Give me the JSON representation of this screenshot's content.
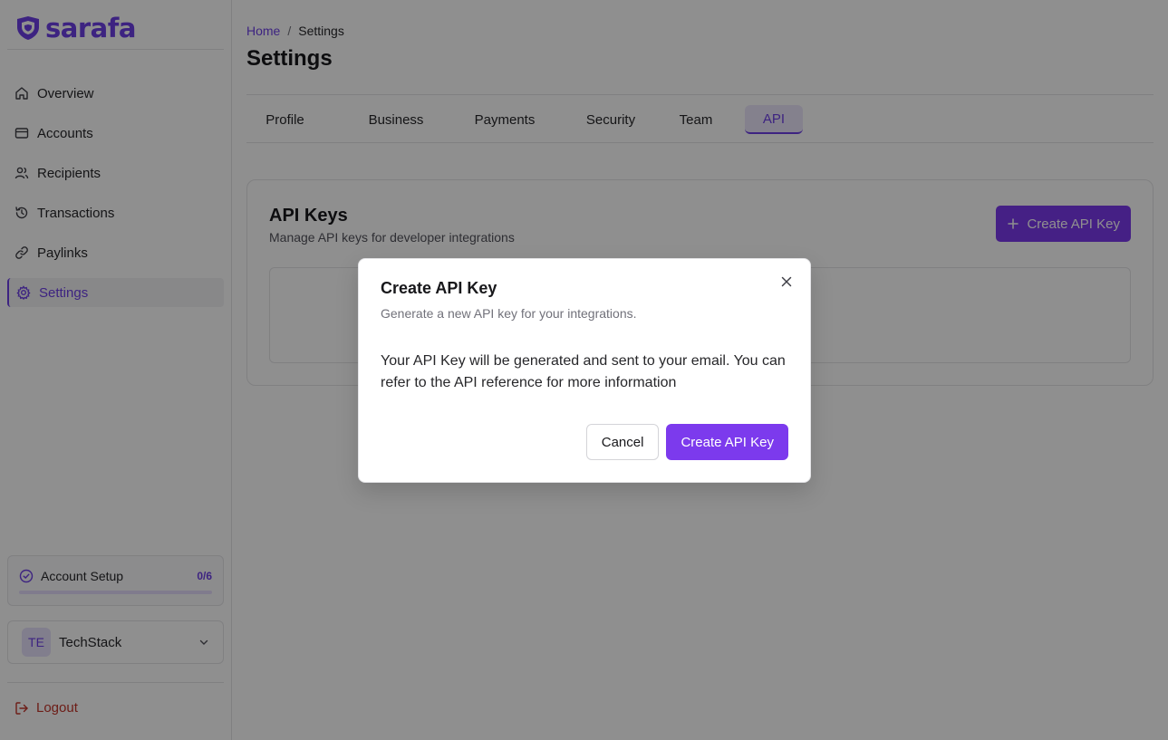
{
  "brand": {
    "name": "sarafa",
    "color": "#6d3fe6"
  },
  "sidebar": {
    "items": [
      {
        "label": "Overview",
        "icon": "home-icon"
      },
      {
        "label": "Accounts",
        "icon": "credit-card-icon"
      },
      {
        "label": "Recipients",
        "icon": "users-icon"
      },
      {
        "label": "Transactions",
        "icon": "history-icon"
      },
      {
        "label": "Paylinks",
        "icon": "link-icon"
      },
      {
        "label": "Settings",
        "icon": "gear-icon",
        "active": true
      }
    ],
    "account_setup": {
      "label": "Account Setup",
      "count": "0/6",
      "progress": 0
    },
    "account": {
      "initials": "TE",
      "name": "TechStack"
    },
    "logout_label": "Logout"
  },
  "breadcrumb": {
    "home": "Home",
    "separator": "/",
    "current": "Settings"
  },
  "page": {
    "title": "Settings"
  },
  "tabs": [
    {
      "label": "Profile"
    },
    {
      "label": "Business"
    },
    {
      "label": "Payments"
    },
    {
      "label": "Security"
    },
    {
      "label": "Team"
    },
    {
      "label": "API",
      "active": true
    }
  ],
  "api_card": {
    "title": "API Keys",
    "subtitle": "Manage API keys for developer integrations",
    "create_button_label": "Create API Key"
  },
  "modal": {
    "title": "Create API Key",
    "description": "Generate a new API key for your integrations.",
    "body": "Your API Key will be generated and sent to your email. You can refer to the API reference for more information",
    "cancel_label": "Cancel",
    "confirm_label": "Create API Key"
  }
}
